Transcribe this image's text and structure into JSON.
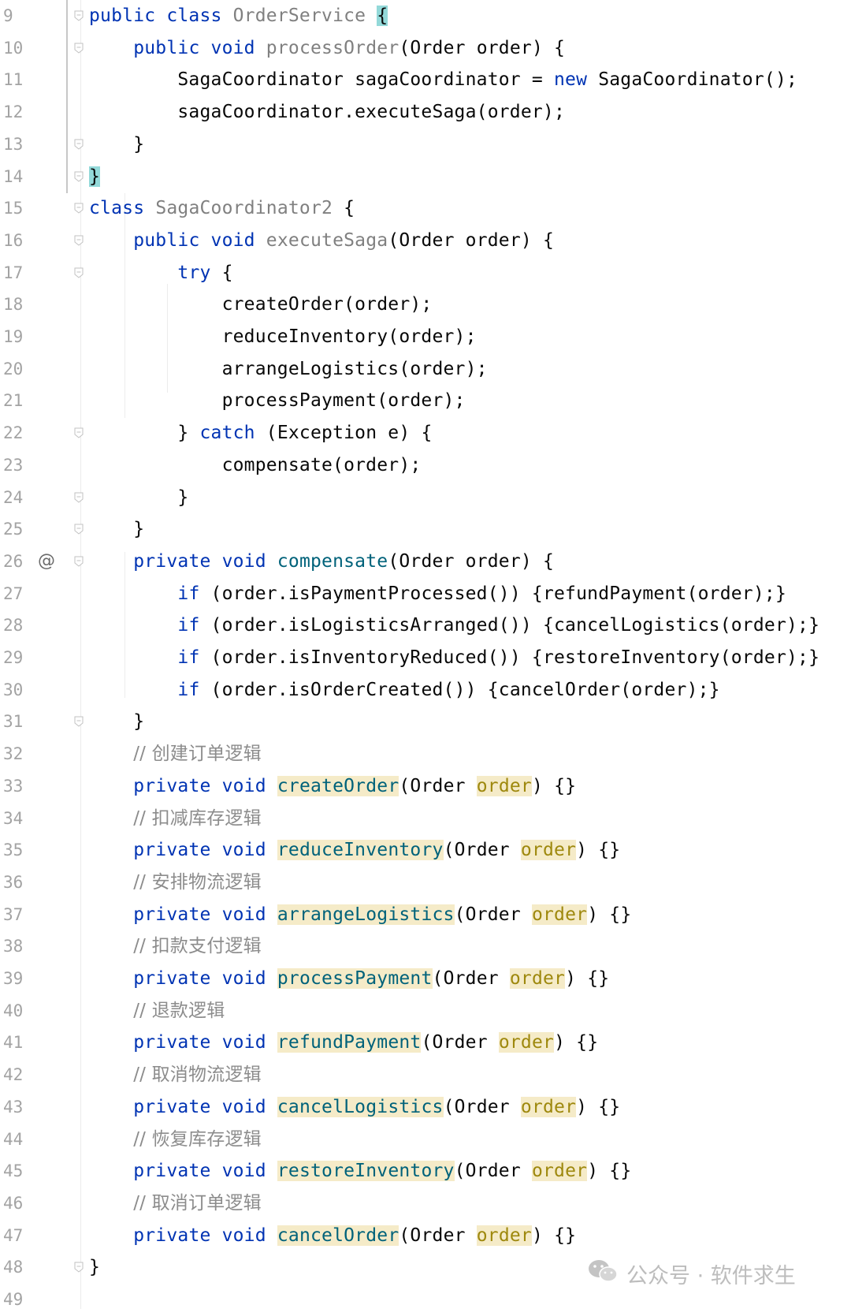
{
  "editor": {
    "lines": [
      {
        "n": "9",
        "html": "<span class='kw'>public class</span> <span class='gray'>OrderService</span> <span class='brace-hl'>{</span>"
      },
      {
        "n": "10",
        "html": "    <span class='kw'>public void</span> <span class='gray'>processOrder</span>(Order order) {"
      },
      {
        "n": "11",
        "html": "        SagaCoordinator sagaCoordinator = <span class='kw'>new</span> SagaCoordinator();"
      },
      {
        "n": "12",
        "html": "        sagaCoordinator.executeSaga(order);"
      },
      {
        "n": "13",
        "html": "    }"
      },
      {
        "n": "14",
        "html": "<span class='brace-hl'>}</span>"
      },
      {
        "n": "15",
        "html": "<span class='kw'>class</span> <span class='gray'>SagaCoordinator2</span> {"
      },
      {
        "n": "16",
        "html": "    <span class='kw'>public void</span> <span class='gray'>executeSaga</span>(Order order) {"
      },
      {
        "n": "17",
        "html": "        <span class='kw'>try</span> {"
      },
      {
        "n": "18",
        "html": "            createOrder(order);"
      },
      {
        "n": "19",
        "html": "            reduceInventory(order);"
      },
      {
        "n": "20",
        "html": "            arrangeLogistics(order);"
      },
      {
        "n": "21",
        "html": "            processPayment(order);"
      },
      {
        "n": "22",
        "html": "        } <span class='kw'>catch</span> (Exception e) {"
      },
      {
        "n": "23",
        "html": "            compensate(order);"
      },
      {
        "n": "24",
        "html": "        }"
      },
      {
        "n": "25",
        "html": "    }"
      },
      {
        "n": "26",
        "html": "    <span class='kw'>private void</span> <span class='fn-decl'>compensate</span>(Order order) {"
      },
      {
        "n": "27",
        "html": "        <span class='kw'>if</span> (order.isPaymentProcessed()) {refundPayment(order);}"
      },
      {
        "n": "28",
        "html": "        <span class='kw'>if</span> (order.isLogisticsArranged()) {cancelLogistics(order);}"
      },
      {
        "n": "29",
        "html": "        <span class='kw'>if</span> (order.isInventoryReduced()) {restoreInventory(order);}"
      },
      {
        "n": "30",
        "html": "        <span class='kw'>if</span> (order.isOrderCreated()) {cancelOrder(order);}"
      },
      {
        "n": "31",
        "html": "    }"
      },
      {
        "n": "32",
        "html": "    <span class='cmt'>// 创建订单逻辑</span>"
      },
      {
        "n": "33",
        "html": "    <span class='kw'>private void</span> <span class='unused'>createOrder</span>(Order <span class='unused-param'>order</span>) {}"
      },
      {
        "n": "34",
        "html": "    <span class='cmt'>// 扣减库存逻辑</span>"
      },
      {
        "n": "35",
        "html": "    <span class='kw'>private void</span> <span class='unused'>reduceInventory</span>(Order <span class='unused-param'>order</span>) {}"
      },
      {
        "n": "36",
        "html": "    <span class='cmt'>// 安排物流逻辑</span>"
      },
      {
        "n": "37",
        "html": "    <span class='kw'>private void</span> <span class='unused'>arrangeLogistics</span>(Order <span class='unused-param'>order</span>) {}"
      },
      {
        "n": "38",
        "html": "    <span class='cmt'>// 扣款支付逻辑</span>"
      },
      {
        "n": "39",
        "html": "    <span class='kw'>private void</span> <span class='unused'>processPayment</span>(Order <span class='unused-param'>order</span>) {}"
      },
      {
        "n": "40",
        "html": "    <span class='cmt'>// 退款逻辑</span>"
      },
      {
        "n": "41",
        "html": "    <span class='kw'>private void</span> <span class='unused'>refundPayment</span>(Order <span class='unused-param'>order</span>) {}"
      },
      {
        "n": "42",
        "html": "    <span class='cmt'>// 取消物流逻辑</span>"
      },
      {
        "n": "43",
        "html": "    <span class='kw'>private void</span> <span class='unused'>cancelLogistics</span>(Order <span class='unused-param'>order</span>) {}"
      },
      {
        "n": "44",
        "html": "    <span class='cmt'>// 恢复库存逻辑</span>"
      },
      {
        "n": "45",
        "html": "    <span class='kw'>private void</span> <span class='unused'>restoreInventory</span>(Order <span class='unused-param'>order</span>) {}"
      },
      {
        "n": "46",
        "html": "    <span class='cmt'>// 取消订单逻辑</span>"
      },
      {
        "n": "47",
        "html": "    <span class='kw'>private void</span> <span class='unused'>cancelOrder</span>(Order <span class='unused-param'>order</span>) {}"
      },
      {
        "n": "48",
        "html": "}"
      },
      {
        "n": "49",
        "html": ""
      }
    ],
    "fold_marker_lines": [
      "9",
      "10",
      "13",
      "14",
      "15",
      "16",
      "17",
      "22",
      "24",
      "25",
      "26",
      "31",
      "48"
    ],
    "override_marker": {
      "line": "26",
      "symbol": "@"
    }
  },
  "watermark": {
    "icon": "wechat-icon",
    "text": "公众号 · 软件求生"
  },
  "colors": {
    "keyword": "#0033b3",
    "unused_highlight": "#f5ebc8",
    "brace_match": "#93d9d9",
    "line_number": "#a3a3a3"
  }
}
